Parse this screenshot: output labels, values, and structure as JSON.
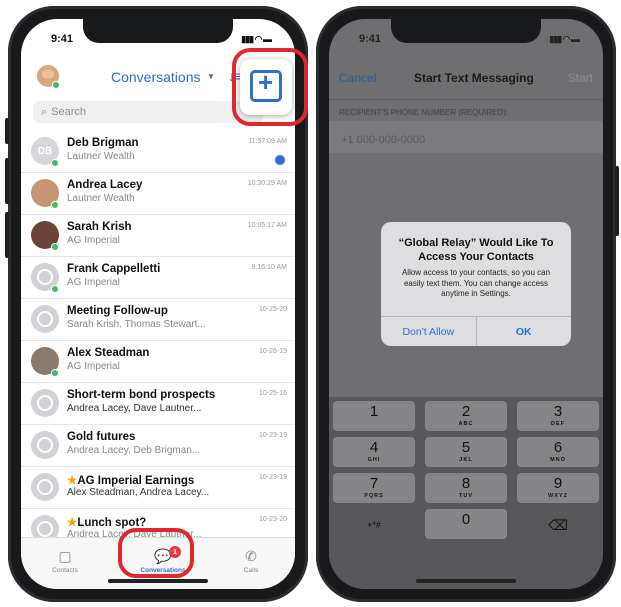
{
  "left_phone": {
    "status_time": "9:41",
    "status_icons": "▮▮▮ ◠ ▬",
    "header": {
      "title": "Conversations",
      "caret": "▼",
      "sort_icon": "↓≡"
    },
    "search": {
      "icon": "⌕",
      "placeholder": "Search"
    },
    "conversations": [
      {
        "name": "Deb Brigman",
        "sub": "Lautner Wealth",
        "time": "11:57:09 AM",
        "initials": "DB",
        "unread": true
      },
      {
        "name": "Andrea Lacey",
        "sub": "Lautner Wealth",
        "time": "10:30:29 AM"
      },
      {
        "name": "Sarah Krish",
        "sub": "AG Imperial",
        "time": "10:05:17 AM"
      },
      {
        "name": "Frank Cappelletti",
        "sub": "AG Imperial",
        "time": "9:16:10 AM"
      },
      {
        "name": "Meeting Follow-up",
        "sub": "Sarah Krish, Thomas Stewart...",
        "time": "10-25-20"
      },
      {
        "name": "Alex Steadman",
        "sub": "AG Imperial",
        "time": "10-26-19"
      },
      {
        "name": "Short-term bond prospects",
        "sub": "Andrea Lacey, Dave Lautner...",
        "time": "10-25-16"
      },
      {
        "name": "Gold futures",
        "sub": "Andrea Lacey, Deb Brigman...",
        "time": "10-23-19"
      },
      {
        "name": "AG Imperial Earnings",
        "sub": "Alex Steadman, Andrea Lacey...",
        "time": "10-23-19",
        "star": true
      },
      {
        "name": "Lunch spot?",
        "sub": "Andrea Lacey, Dave Lautner...",
        "time": "10-23-20",
        "star": true
      }
    ],
    "star_glyph": "★",
    "tabbar": {
      "contacts": "Contacts",
      "conversations": "Conversations",
      "calls": "Calls",
      "badge": "1",
      "contacts_icon": "▢",
      "conversations_icon": "💬",
      "calls_icon": "✆"
    }
  },
  "right_phone": {
    "status_time": "9:41",
    "status_icons": "▮▮▮ ◠ ▬",
    "nav": {
      "cancel": "Cancel",
      "title": "Start Text Messaging",
      "start": "Start"
    },
    "recipient_label": "RECIPIENT'S PHONE NUMBER (REQUIRED):",
    "phone_placeholder": "+1 000-000-0000",
    "alert": {
      "title": "“Global Relay” Would Like To Access Your Contacts",
      "message": "Allow access to your contacts, so you can easily text them. You can change access anytime in Settings.",
      "deny": "Don't Allow",
      "ok": "OK"
    },
    "keypad": [
      {
        "digit": "1",
        "letters": ""
      },
      {
        "digit": "2",
        "letters": "ABC"
      },
      {
        "digit": "3",
        "letters": "DEF"
      },
      {
        "digit": "4",
        "letters": "GHI"
      },
      {
        "digit": "5",
        "letters": "JKL"
      },
      {
        "digit": "6",
        "letters": "MNO"
      },
      {
        "digit": "7",
        "letters": "PQRS"
      },
      {
        "digit": "8",
        "letters": "TUV"
      },
      {
        "digit": "9",
        "letters": "WXYZ"
      },
      {
        "digit": "+*#",
        "letters": ""
      },
      {
        "digit": "0",
        "letters": ""
      },
      {
        "digit": "⌫",
        "letters": ""
      }
    ]
  },
  "colors": {
    "accent": "#2a6fd6",
    "highlight_ring": "#e2262e",
    "presence": "#3fbf5a",
    "badge": "#e8384a"
  }
}
